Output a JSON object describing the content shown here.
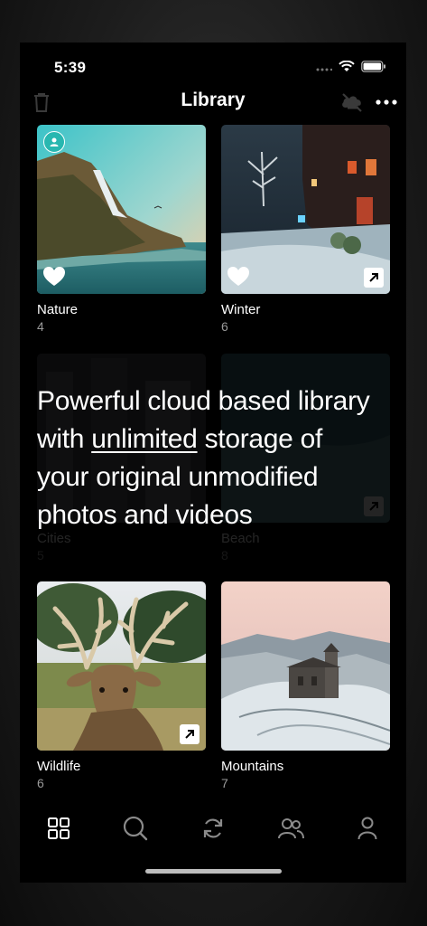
{
  "status_bar": {
    "time": "5:39"
  },
  "nav": {
    "title": "Library"
  },
  "albums": [
    {
      "name": "Nature",
      "count": "4"
    },
    {
      "name": "Winter",
      "count": "6"
    },
    {
      "name": "Cities",
      "count": "5"
    },
    {
      "name": "Beach",
      "count": "8"
    },
    {
      "name": "Wildlife",
      "count": "6"
    },
    {
      "name": "Mountains",
      "count": "7"
    }
  ],
  "promo": {
    "line1": "Powerful cloud based library",
    "with": "with ",
    "emphasis": "unlimited",
    "after": " storage of",
    "line3": "your original unmodified",
    "line4": "photos and videos"
  },
  "icons": {
    "trash": "trash-icon",
    "cloud_off": "cloud-off-icon",
    "more": "more-icon",
    "tabs": [
      "grid-icon",
      "search-icon",
      "sync-icon",
      "people-icon",
      "person-icon"
    ]
  },
  "colors": {
    "background": "#000000",
    "accent_user_badge": "#28b7b0",
    "secondary_text": "#9a9a9a"
  }
}
